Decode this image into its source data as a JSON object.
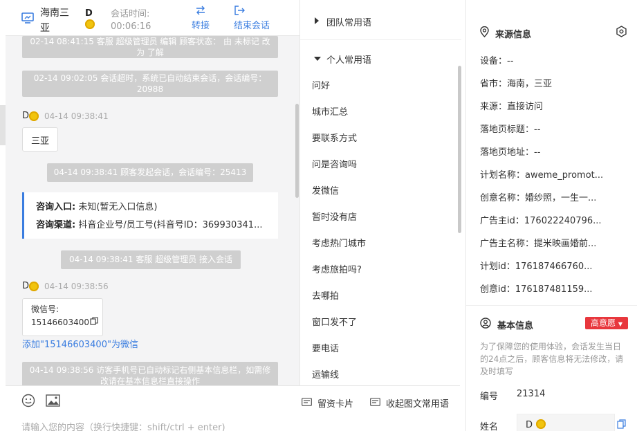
{
  "header": {
    "location": "海南三亚",
    "customer_initial": "D",
    "session_time_label": "会话时间:",
    "session_time_value": "00:06:16",
    "transfer_label": "转接",
    "end_label": "结束会话"
  },
  "messages": {
    "sys1": "02-14 08:41:15 客服 超级管理员 编辑 顾客状态： 由 未标记 改为 了解",
    "sys2": "02-14 09:02:05 会话超时，系统已自动结束会话，会话编号：20988",
    "msg1_name": "D",
    "msg1_time": "04-14 09:38:41",
    "msg1_text": "三亚",
    "sys3": "04-14 09:38:41 顾客发起会话，会话编号：25413",
    "entry_label": "咨询入口:",
    "entry_value": "未知(暂无入口信息)",
    "channel_label": "咨询渠道:",
    "channel_value": "抖音企业号/员工号(抖音号ID：369930341...",
    "sys4": "04-14 09:38:41 客服 超级管理员 接入会话",
    "msg2_name": "D",
    "msg2_time": "04-14 09:38:56",
    "msg2_line1": "微信号:",
    "msg2_line2": "15146603400",
    "add_wechat": "添加\"15146603400\"为微信",
    "sys5": "04-14 09:38:56 访客手机号已自动标记右侧基本信息栏，如需修改请在基本信息栏直接操作"
  },
  "footer": {
    "input_placeholder": "请输入您的内容（换行快捷键：shift/ctrl + enter)",
    "card_label": "留资卡片",
    "collapse_label": "收起图文常用语"
  },
  "phrases": {
    "team_group": "团队常用语",
    "personal_group": "个人常用语",
    "items": [
      "问好",
      "城市汇总",
      "要联系方式",
      "问是咨询吗",
      "发微信",
      "暂时没有店",
      "考虑热门城市",
      "考虑旅拍吗?",
      "去哪拍",
      "窗口发不了",
      "要电话",
      "运输线"
    ]
  },
  "source": {
    "title": "来源信息",
    "rows": [
      {
        "k": "设备：",
        "v": "--"
      },
      {
        "k": "省市：",
        "v": "海南，三亚"
      },
      {
        "k": "来源：",
        "v": "直接访问"
      },
      {
        "k": "落地页标题：",
        "v": "--"
      },
      {
        "k": "落地页地址：",
        "v": "--"
      },
      {
        "k": "计划名称：",
        "v": "aweme_promot..."
      },
      {
        "k": "创意名称：",
        "v": "婚纱照，一生一..."
      },
      {
        "k": "广告主id：",
        "v": "176022240796..."
      },
      {
        "k": "广告主名称：",
        "v": "提米映画婚前..."
      },
      {
        "k": "计划id：",
        "v": "176187466760..."
      },
      {
        "k": "创意id：",
        "v": "176187481159..."
      }
    ]
  },
  "basic": {
    "title": "基本信息",
    "intent": "高意愿",
    "note": "为了保障您的使用体验，会话发生当日的24点之后，顾客信息将无法修改，请及时填写",
    "id_label": "编号",
    "id_value": "21314",
    "name_label": "姓名",
    "name_value": "D"
  },
  "colors": {
    "accent": "#3a7de0",
    "intent": "#e8373d",
    "system_msg": "#cfcfcf"
  }
}
